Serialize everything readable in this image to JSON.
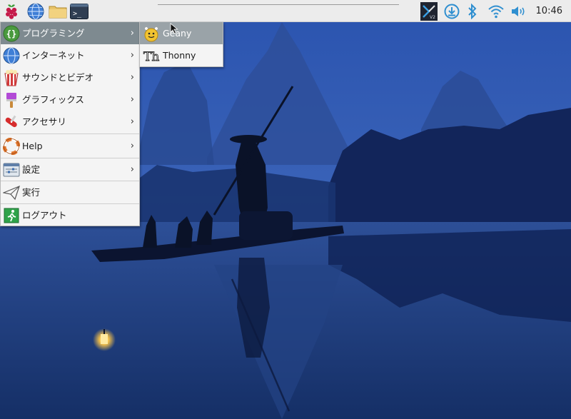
{
  "panel": {
    "launchers": [
      {
        "name": "raspberry-menu-icon"
      },
      {
        "name": "web-browser-icon"
      },
      {
        "name": "file-manager-icon"
      },
      {
        "name": "terminal-icon",
        "glyph": ">_"
      }
    ],
    "tray": [
      {
        "name": "vnc-icon",
        "glyph": "V2"
      },
      {
        "name": "updater-icon"
      },
      {
        "name": "bluetooth-icon"
      },
      {
        "name": "wifi-icon"
      },
      {
        "name": "volume-icon"
      }
    ],
    "clock": "10:46"
  },
  "menu": {
    "items": [
      {
        "label": "プログラミング",
        "icon": "braces-icon",
        "has_submenu": true
      },
      {
        "label": "インターネット",
        "icon": "globe-icon",
        "has_submenu": true
      },
      {
        "label": "サウンドとビデオ",
        "icon": "popcorn-icon",
        "has_submenu": true
      },
      {
        "label": "グラフィックス",
        "icon": "paintbrush-icon",
        "has_submenu": true
      },
      {
        "label": "アクセサリ",
        "icon": "swiss-knife-icon",
        "has_submenu": true
      },
      {
        "label": "Help",
        "icon": "lifebuoy-icon",
        "has_submenu": true
      },
      {
        "label": "設定",
        "icon": "settings-panel-icon",
        "has_submenu": true
      },
      {
        "label": "実行",
        "icon": "paper-plane-icon",
        "has_submenu": false
      },
      {
        "label": "ログアウト",
        "icon": "exit-icon",
        "has_submenu": false
      }
    ],
    "arrow": "›"
  },
  "submenu": {
    "items": [
      {
        "label": "Geany",
        "icon": "geany-icon"
      },
      {
        "label": "Thonny",
        "icon": "thonny-icon",
        "glyph": "Th"
      }
    ]
  },
  "colors": {
    "panel_bg": "#ececec",
    "menu_bg": "#f4f4f4",
    "menu_highlight": "#7e8a90",
    "wallpaper_sky": "#2b52a6",
    "wallpaper_water": "#1b3a72"
  }
}
